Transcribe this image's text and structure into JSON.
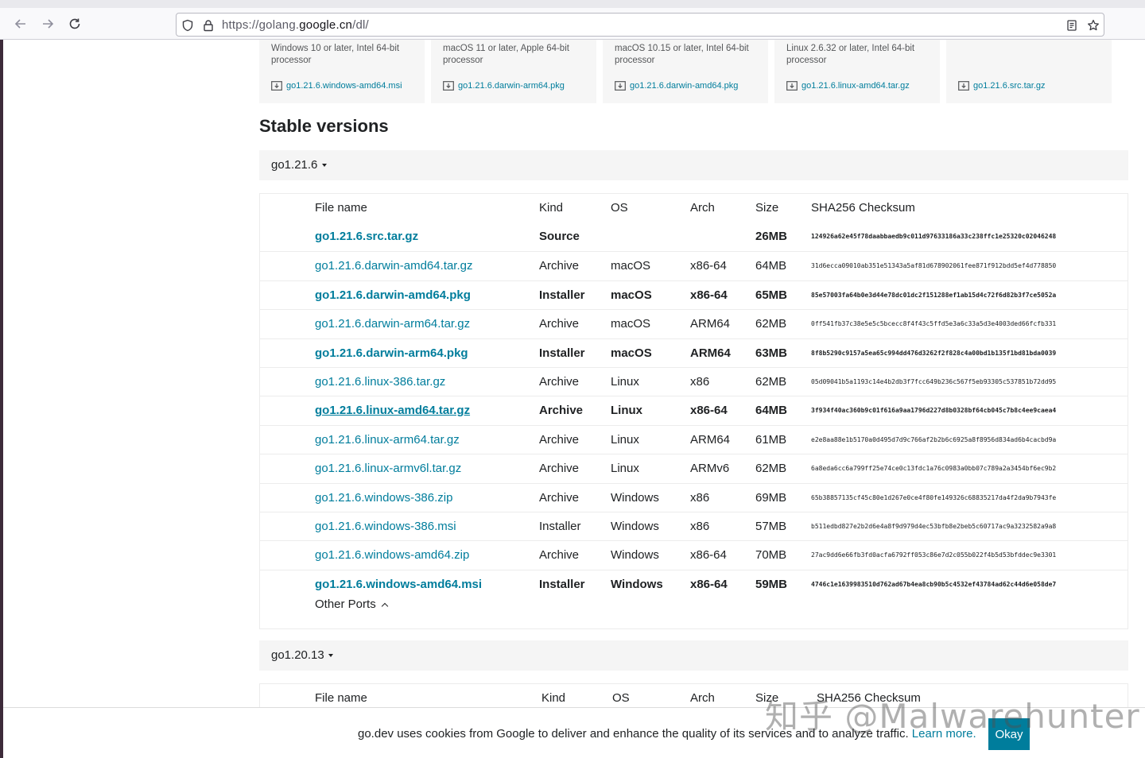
{
  "browser": {
    "url_prefix": "https://golang.",
    "url_domain": "google.cn",
    "url_path": "/dl/"
  },
  "featured": [
    {
      "desc": "Windows 10 or later, Intel 64-bit processor",
      "file": "go1.21.6.windows-amd64.msi"
    },
    {
      "desc": "macOS 11 or later, Apple 64-bit processor",
      "file": "go1.21.6.darwin-arm64.pkg"
    },
    {
      "desc": "macOS 10.15 or later, Intel 64-bit processor",
      "file": "go1.21.6.darwin-amd64.pkg"
    },
    {
      "desc": "Linux 2.6.32 or later, Intel 64-bit processor",
      "file": "go1.21.6.linux-amd64.tar.gz"
    },
    {
      "desc": "",
      "file": "go1.21.6.src.tar.gz"
    }
  ],
  "section_title": "Stable versions",
  "columns": {
    "file": "File name",
    "kind": "Kind",
    "os": "OS",
    "arch": "Arch",
    "size": "Size",
    "sha": "SHA256 Checksum"
  },
  "versions": [
    {
      "name": "go1.21.6",
      "rows": [
        {
          "file": "go1.21.6.src.tar.gz",
          "kind": "Source",
          "os": "",
          "arch": "",
          "size": "26MB",
          "sha": "124926a62e45f78daabbaedb9c011d97633186a33c238ffc1e25320c02046248",
          "bold": true
        },
        {
          "file": "go1.21.6.darwin-amd64.tar.gz",
          "kind": "Archive",
          "os": "macOS",
          "arch": "x86-64",
          "size": "64MB",
          "sha": "31d6ecca09010ab351e51343a5af81d678902061fee871f912bdd5ef4d778850",
          "bold": false
        },
        {
          "file": "go1.21.6.darwin-amd64.pkg",
          "kind": "Installer",
          "os": "macOS",
          "arch": "x86-64",
          "size": "65MB",
          "sha": "85e57003fa64b0e3d44e78dc01dc2f151288ef1ab15d4c72f6d82b3f7ce5052a",
          "bold": true
        },
        {
          "file": "go1.21.6.darwin-arm64.tar.gz",
          "kind": "Archive",
          "os": "macOS",
          "arch": "ARM64",
          "size": "62MB",
          "sha": "0ff541fb37c38e5e5c5bcecc8f4f43c5ffd5e3a6c33a5d3e4003ded66fcfb331",
          "bold": false
        },
        {
          "file": "go1.21.6.darwin-arm64.pkg",
          "kind": "Installer",
          "os": "macOS",
          "arch": "ARM64",
          "size": "63MB",
          "sha": "8f8b5290c9157a5ea65c994dd476d3262f2f828c4a00bd1b135f1bd81bda0039",
          "bold": true
        },
        {
          "file": "go1.21.6.linux-386.tar.gz",
          "kind": "Archive",
          "os": "Linux",
          "arch": "x86",
          "size": "62MB",
          "sha": "05d09041b5a1193c14e4b2db3f7fcc649b236c567f5eb93305c537851b72dd95",
          "bold": false
        },
        {
          "file": "go1.21.6.linux-amd64.tar.gz",
          "kind": "Archive",
          "os": "Linux",
          "arch": "x86-64",
          "size": "64MB",
          "sha": "3f934f40ac360b9c01f616a9aa1796d227d8b0328bf64cb045c7b8c4ee9caea4",
          "bold": true,
          "underline": true
        },
        {
          "file": "go1.21.6.linux-arm64.tar.gz",
          "kind": "Archive",
          "os": "Linux",
          "arch": "ARM64",
          "size": "61MB",
          "sha": "e2e8aa88e1b5170a0d495d7d9c766af2b2b6c6925a8f8956d834ad6b4cacbd9a",
          "bold": false
        },
        {
          "file": "go1.21.6.linux-armv6l.tar.gz",
          "kind": "Archive",
          "os": "Linux",
          "arch": "ARMv6",
          "size": "62MB",
          "sha": "6a8eda6cc6a799ff25e74ce0c13fdc1a76c0983a0bb07c789a2a3454bf6ec9b2",
          "bold": false
        },
        {
          "file": "go1.21.6.windows-386.zip",
          "kind": "Archive",
          "os": "Windows",
          "arch": "x86",
          "size": "69MB",
          "sha": "65b38857135cf45c80e1d267e0ce4f80fe149326c68835217da4f2da9b7943fe",
          "bold": false
        },
        {
          "file": "go1.21.6.windows-386.msi",
          "kind": "Installer",
          "os": "Windows",
          "arch": "x86",
          "size": "57MB",
          "sha": "b511edbd827e2b2d6e4a8f9d979d4ec53bfb8e2beb5c60717ac9a3232582a9a8",
          "bold": false
        },
        {
          "file": "go1.21.6.windows-amd64.zip",
          "kind": "Archive",
          "os": "Windows",
          "arch": "x86-64",
          "size": "70MB",
          "sha": "27ac9dd6e66fb3fd0acfa6792ff053c86e7d2c055b022f4b5d53bfddec9e3301",
          "bold": false
        },
        {
          "file": "go1.21.6.windows-amd64.msi",
          "kind": "Installer",
          "os": "Windows",
          "arch": "x86-64",
          "size": "59MB",
          "sha": "4746c1e1639983510d762ad67b4ea8cb90b5c4532ef43784ad62c44d6e058de7",
          "bold": true
        }
      ],
      "other_ports": "Other Ports"
    },
    {
      "name": "go1.20.13"
    }
  ],
  "cookie": {
    "text": "go.dev uses cookies from Google to deliver and enhance the quality of its services and to analyze traffic.",
    "link": "Learn more.",
    "button": "Okay"
  },
  "watermark": "知乎 @Malwarehunter",
  "colors": {
    "link": "#007d9c",
    "text": "#202224",
    "header_bg": "#f5f5f5"
  }
}
